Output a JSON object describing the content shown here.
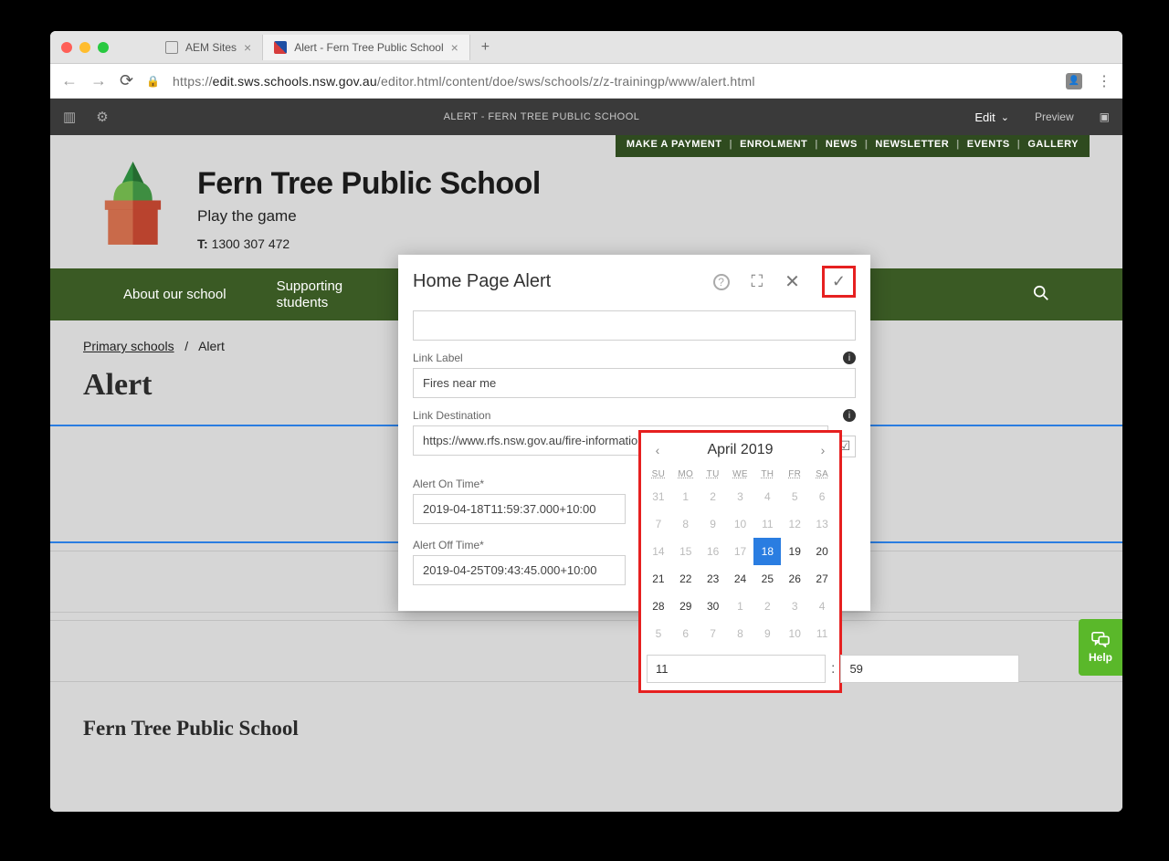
{
  "browser": {
    "tabs": [
      {
        "label": "AEM Sites",
        "active": false
      },
      {
        "label": "Alert - Fern Tree Public School",
        "active": true
      }
    ],
    "url_prefix": "https://",
    "url_host": "edit.sws.schools.nsw.gov.au",
    "url_path": "/editor.html/content/doe/sws/schools/z/z-trainingp/www/alert.html"
  },
  "aem": {
    "title": "ALERT - FERN TREE PUBLIC SCHOOL",
    "edit": "Edit",
    "preview": "Preview"
  },
  "header_links": [
    "MAKE A PAYMENT",
    "ENROLMENT",
    "NEWS",
    "NEWSLETTER",
    "EVENTS",
    "GALLERY"
  ],
  "school": {
    "name": "Fern Tree Public School",
    "tagline": "Play the game",
    "phone_label": "T:",
    "phone": "1300 307 472"
  },
  "nav": [
    "About our school",
    "Supporting students"
  ],
  "breadcrumb": {
    "parent": "Primary schools",
    "sep": "/",
    "current": "Alert"
  },
  "page_heading": "Alert",
  "footer_title": "Fern Tree Public School",
  "dialog": {
    "title": "Home Page Alert",
    "link_label_field": "Link Label",
    "link_label_value": "Fires near me",
    "link_dest_field": "Link Destination",
    "link_dest_value": "https://www.rfs.nsw.gov.au/fire-information/fires-near-me",
    "on_label": "Alert On Time*",
    "on_value": "2019-04-18T11:59:37.000+10:00",
    "off_label": "Alert Off Time*",
    "off_value": "2019-04-25T09:43:45.000+10:00"
  },
  "calendar": {
    "month": "April 2019",
    "dow": [
      "SU",
      "MO",
      "TU",
      "WE",
      "TH",
      "FR",
      "SA"
    ],
    "weeks": [
      [
        {
          "d": "31",
          "o": true
        },
        {
          "d": "1",
          "o": true
        },
        {
          "d": "2",
          "o": true
        },
        {
          "d": "3",
          "o": true
        },
        {
          "d": "4",
          "o": true
        },
        {
          "d": "5",
          "o": true
        },
        {
          "d": "6",
          "o": true
        }
      ],
      [
        {
          "d": "7",
          "o": true
        },
        {
          "d": "8",
          "o": true
        },
        {
          "d": "9",
          "o": true
        },
        {
          "d": "10",
          "o": true
        },
        {
          "d": "11",
          "o": true
        },
        {
          "d": "12",
          "o": true
        },
        {
          "d": "13",
          "o": true
        }
      ],
      [
        {
          "d": "14",
          "o": true
        },
        {
          "d": "15",
          "o": true
        },
        {
          "d": "16",
          "o": true
        },
        {
          "d": "17",
          "o": true
        },
        {
          "d": "18",
          "sel": true
        },
        {
          "d": "19"
        },
        {
          "d": "20"
        }
      ],
      [
        {
          "d": "21"
        },
        {
          "d": "22"
        },
        {
          "d": "23"
        },
        {
          "d": "24"
        },
        {
          "d": "25"
        },
        {
          "d": "26"
        },
        {
          "d": "27"
        }
      ],
      [
        {
          "d": "28"
        },
        {
          "d": "29"
        },
        {
          "d": "30"
        },
        {
          "d": "1",
          "o": true
        },
        {
          "d": "2",
          "o": true
        },
        {
          "d": "3",
          "o": true
        },
        {
          "d": "4",
          "o": true
        }
      ],
      [
        {
          "d": "5",
          "o": true
        },
        {
          "d": "6",
          "o": true
        },
        {
          "d": "7",
          "o": true
        },
        {
          "d": "8",
          "o": true
        },
        {
          "d": "9",
          "o": true
        },
        {
          "d": "10",
          "o": true
        },
        {
          "d": "11",
          "o": true
        }
      ]
    ],
    "hour": "11",
    "minute": "59"
  },
  "help_label": "Help"
}
